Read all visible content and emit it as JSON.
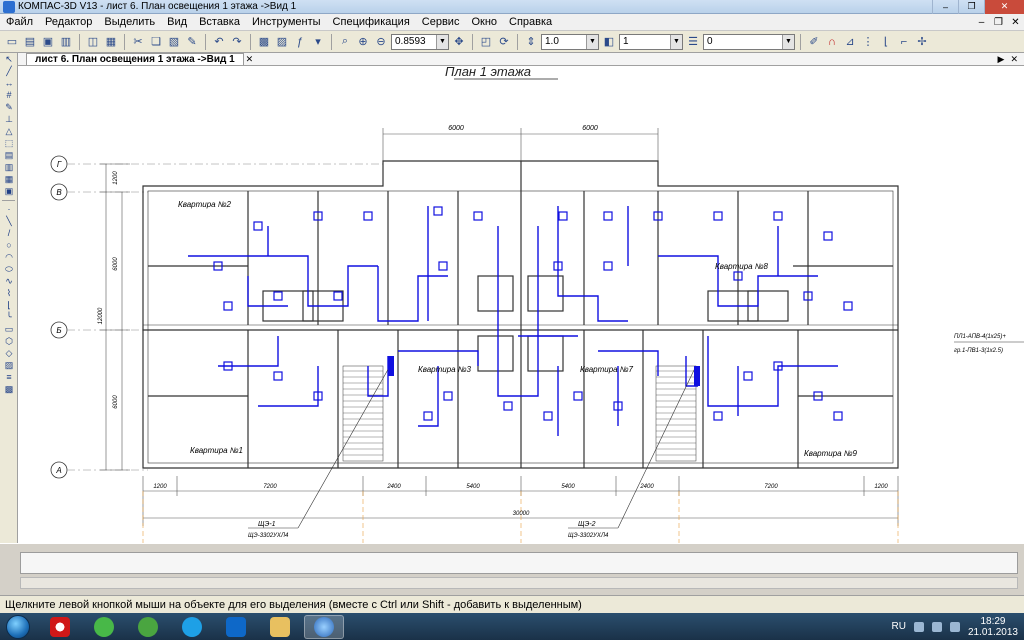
{
  "window": {
    "title": "КОМПАС-3D V13 - лист 6. План освещения 1 этажа ->Вид 1",
    "controls": [
      "–",
      "❐",
      "✕"
    ]
  },
  "menu": {
    "items": [
      "Файл",
      "Редактор",
      "Выделить",
      "Вид",
      "Вставка",
      "Инструменты",
      "Спецификация",
      "Сервис",
      "Окно",
      "Справка"
    ]
  },
  "toolbar": {
    "zoom_value": "0.8593",
    "step_value": "1.0",
    "layer_value": "1",
    "style_value": "0"
  },
  "tab": {
    "label": "лист 6. План освещения 1 этажа ->Вид 1"
  },
  "drawing": {
    "plan_title": "План 1 этажа",
    "axes": [
      "Г",
      "В",
      "Б",
      "А"
    ],
    "top_dims": [
      "6000",
      "6000"
    ],
    "bottom_dims": [
      "1200",
      "7200",
      "2400",
      "5400",
      "5400",
      "2400",
      "7200",
      "1200"
    ],
    "total_dim": "30000",
    "left_dims": [
      "1200",
      "6000",
      "12000",
      "6000"
    ],
    "apartments": [
      "Квартира №2",
      "Квартира №3",
      "Квартира №7",
      "Квартира №8",
      "Квартира №1",
      "Квартира №9"
    ],
    "panels": [
      "ЩЭ-1",
      "ЩЭ-2"
    ],
    "panel_types": [
      "ЩЭ-3302УХЛ4",
      "ЩЭ-3302УХЛ4"
    ],
    "cable_labels": [
      "ПЛ1-АПВ-4(1х25)+",
      "гр.1-ПВ1-3(1х2.5)"
    ]
  },
  "status": {
    "hint": "Щелкните левой кнопкой мыши на объекте для его выделения (вместе с Ctrl или Shift - добавить к выделенным)"
  },
  "tray": {
    "lang": "RU",
    "time": "18:29",
    "date": "21.01.2013"
  },
  "colors": {
    "wiring": "#1010e0",
    "walls": "#333333",
    "dim_lines": "#555555"
  }
}
